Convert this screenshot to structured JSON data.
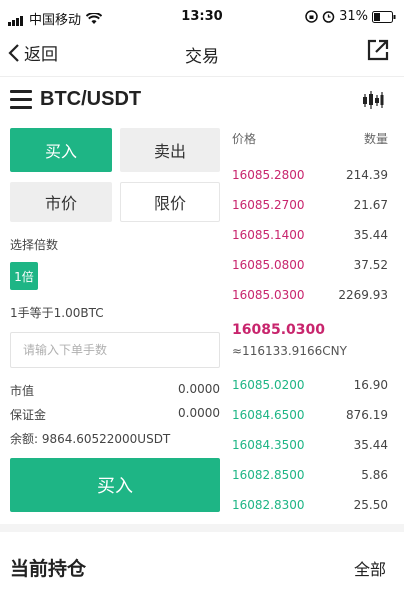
{
  "status_bar": {
    "carrier": "中国移动",
    "time": "13:30",
    "battery": "31%"
  },
  "nav": {
    "back_label": "返回",
    "title": "交易"
  },
  "pair": {
    "name": "BTC/USDT"
  },
  "trade_form": {
    "buy_tab": "买入",
    "sell_tab": "卖出",
    "market_tab": "市价",
    "limit_tab": "限价",
    "multiplier_label": "选择倍数",
    "multiplier_value": "1倍",
    "lot_info": "1手等于1.00BTC",
    "quantity_placeholder": "请输入下单手数",
    "market_value_label": "市值",
    "market_value": "0.0000",
    "margin_label": "保证金",
    "margin": "0.0000",
    "balance": "余额:  9864.60522000USDT",
    "submit_label": "买入"
  },
  "order_book": {
    "price_header": "价格",
    "qty_header": "数量",
    "asks": [
      {
        "price": "16085.2800",
        "qty": "214.39"
      },
      {
        "price": "16085.2700",
        "qty": "21.67"
      },
      {
        "price": "16085.1400",
        "qty": "35.44"
      },
      {
        "price": "16085.0800",
        "qty": "37.52"
      },
      {
        "price": "16085.0300",
        "qty": "2269.93"
      }
    ],
    "last_price": "16085.0300",
    "last_price_cny": "≈116133.9166CNY",
    "bids": [
      {
        "price": "16085.0200",
        "qty": "16.90"
      },
      {
        "price": "16084.6500",
        "qty": "876.19"
      },
      {
        "price": "16084.3500",
        "qty": "35.44"
      },
      {
        "price": "16082.8500",
        "qty": "5.86"
      },
      {
        "price": "16082.8300",
        "qty": "25.50"
      }
    ]
  },
  "positions": {
    "title": "当前持仓",
    "all_label": "全部"
  },
  "colors": {
    "accent_green": "#1eb585",
    "ask_red": "#c8256d"
  }
}
